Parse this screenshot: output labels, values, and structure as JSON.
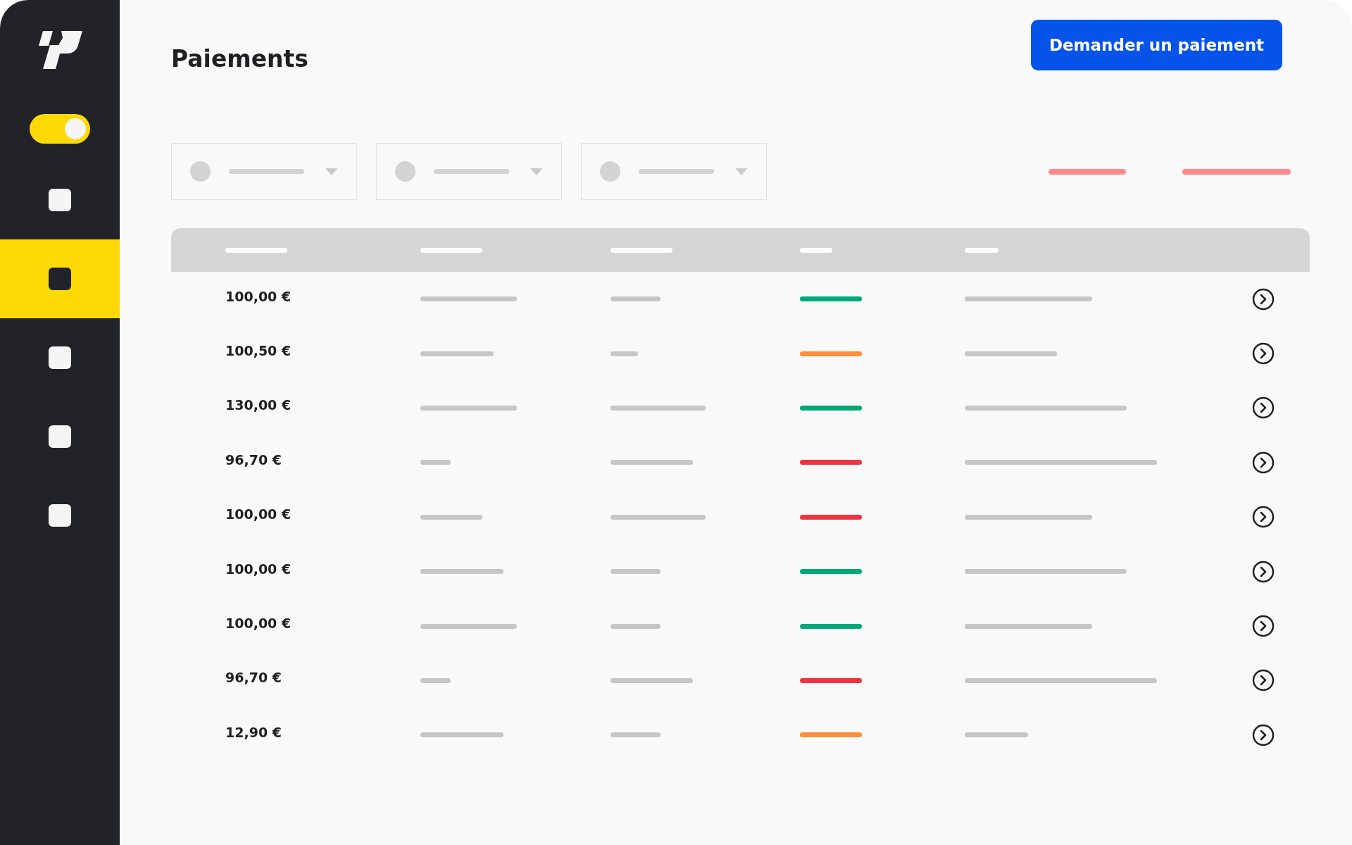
{
  "sidebar": {
    "toggle": {
      "on": true
    },
    "items": [
      {
        "selected": false
      },
      {
        "selected": true
      },
      {
        "selected": false
      },
      {
        "selected": false
      },
      {
        "selected": false
      }
    ]
  },
  "title": "Paiements",
  "primary_button": "Demander un paiement",
  "rows": [
    {
      "amount": "100,00 €",
      "color": "#00a878"
    },
    {
      "amount": "100,50 €",
      "color": "#ff8c3a"
    },
    {
      "amount": "130,00 €",
      "color": "#00a878"
    },
    {
      "amount": "96,70 €",
      "color": "#f2323f"
    },
    {
      "amount": "100,00 €",
      "color": "#f2323f"
    },
    {
      "amount": "100,00 €",
      "color": "#00a878"
    },
    {
      "amount": "100,00 €",
      "color": "#00a878"
    },
    {
      "amount": "96,70 €",
      "color": "#f2323f"
    },
    {
      "amount": "12,90 €",
      "color": "#ff8c3a"
    }
  ]
}
